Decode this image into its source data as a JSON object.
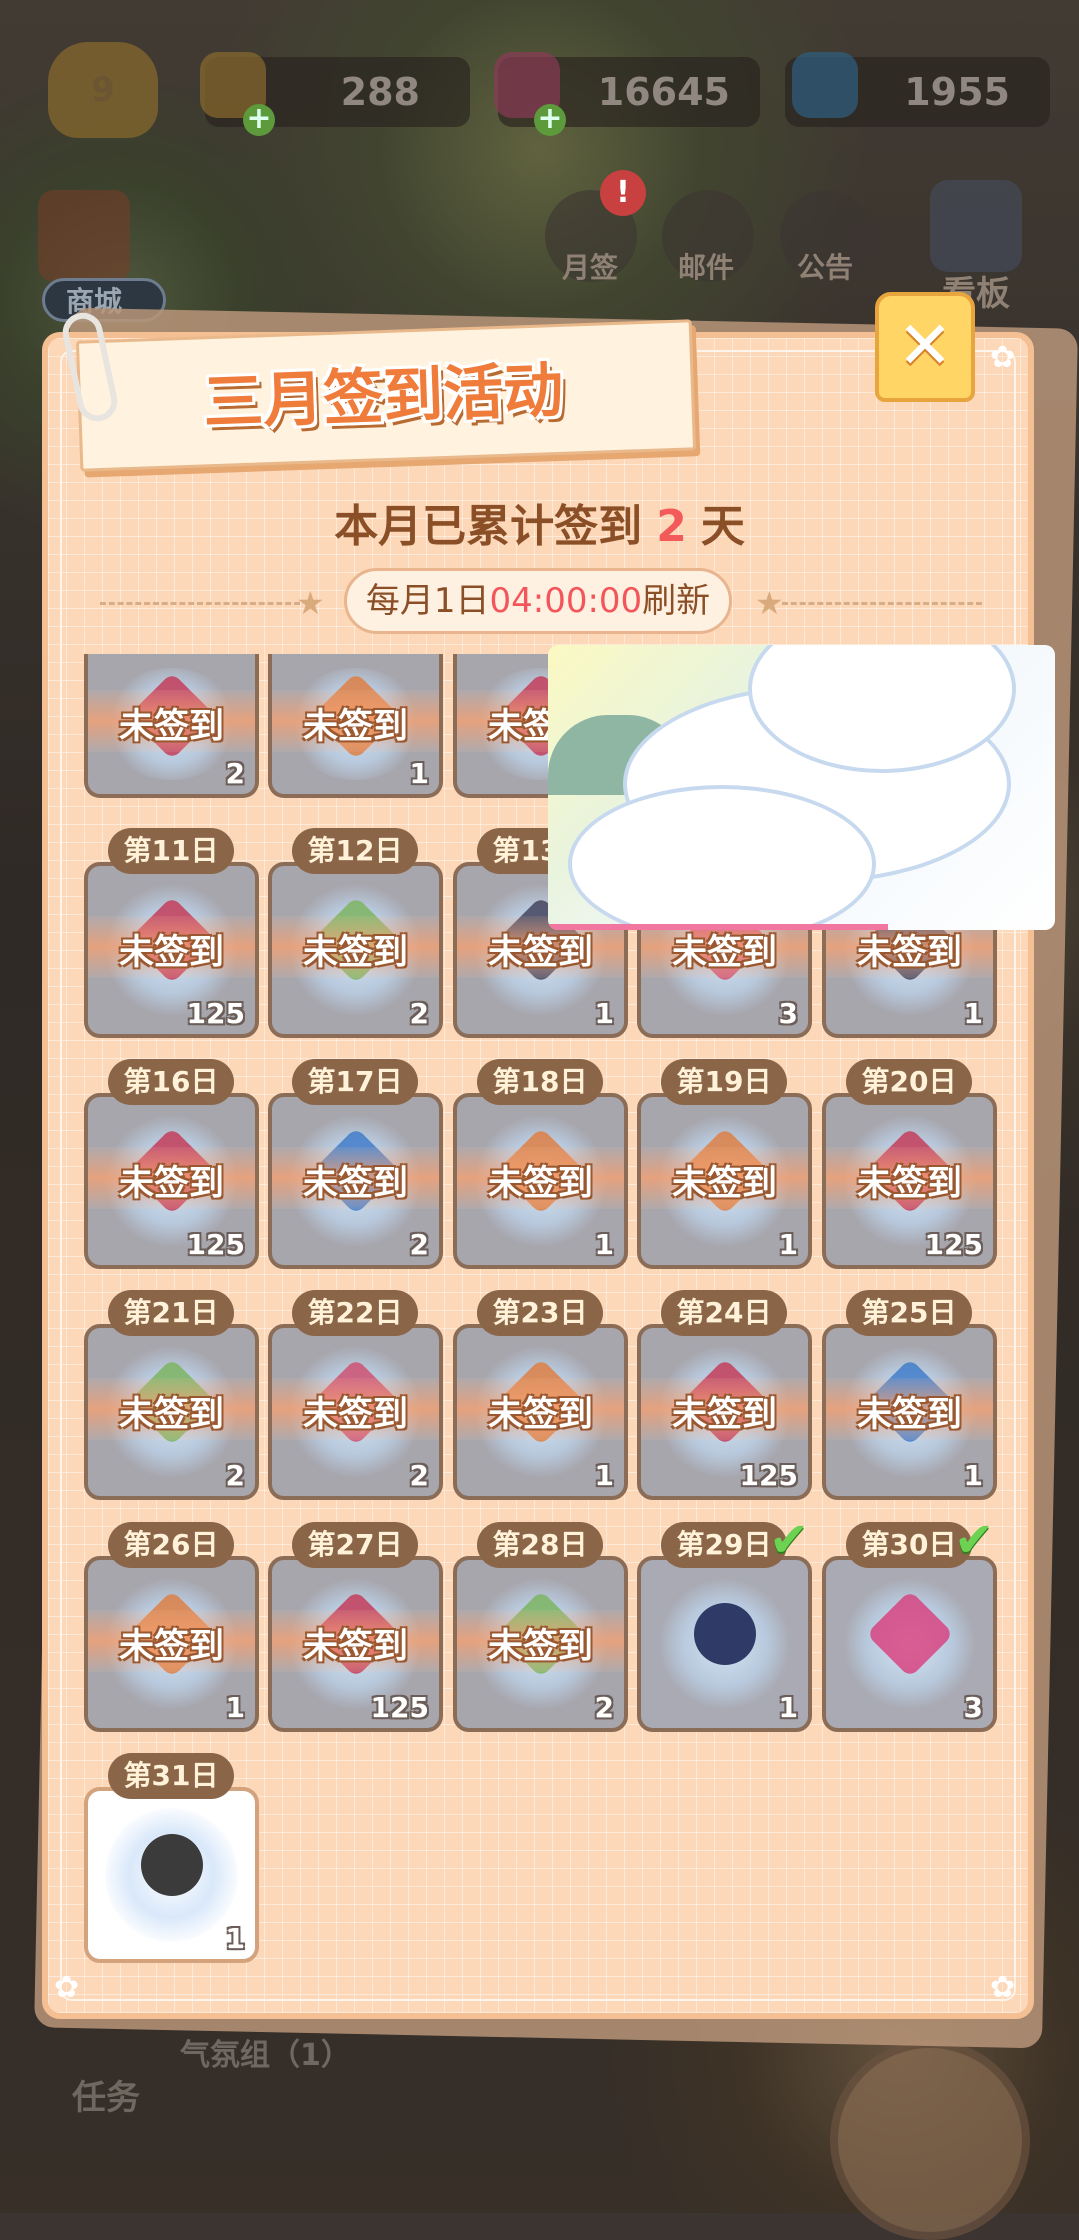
{
  "hud": {
    "level": "9",
    "bells": "288",
    "gems": "16645",
    "snowflakes": "1955",
    "shop_label": "商城",
    "mail_checkin_label": "月签",
    "mail_label": "邮件",
    "notice_label": "公告",
    "board_label": "看板",
    "task_label": "任务",
    "group_label": "气氛组（1）"
  },
  "modal": {
    "title": "三月签到活动",
    "summary_prefix": "本月已累计签到",
    "summary_count": "2",
    "summary_suffix": "天",
    "refresh_prefix": "每月1日",
    "refresh_time": "04:00:00",
    "refresh_suffix": "刷新",
    "close_icon": "close-icon"
  },
  "colors": {
    "accent": "#f07c3b",
    "panel": "#fcd7b8",
    "highlight": "#f3565a",
    "check": "#6cd251"
  },
  "rows": [
    {
      "cells": [
        {
          "day": "",
          "status": "未签到",
          "qty": "2",
          "item": "red-gem",
          "state": "pending"
        },
        {
          "day": "",
          "status": "未签到",
          "qty": "1",
          "item": "orange-item",
          "state": "pending"
        },
        {
          "day": "",
          "status": "未签到",
          "qty": "",
          "item": "red-gem",
          "state": "pending"
        }
      ]
    },
    {
      "cells": [
        {
          "day": "第11日",
          "status": "未签到",
          "qty": "125",
          "item": "red-gem",
          "state": "pending"
        },
        {
          "day": "第12日",
          "status": "未签到",
          "qty": "2",
          "item": "green-item",
          "state": "pending"
        },
        {
          "day": "第13日",
          "status": "未签到",
          "qty": "1",
          "item": "dark-item",
          "state": "pending"
        },
        {
          "day": "",
          "status": "未签到",
          "qty": "3",
          "item": "ticket",
          "state": "pending"
        },
        {
          "day": "",
          "status": "未签到",
          "qty": "1",
          "item": "dark-item",
          "state": "pending"
        }
      ]
    },
    {
      "cells": [
        {
          "day": "第16日",
          "status": "未签到",
          "qty": "125",
          "item": "red-gem",
          "state": "pending"
        },
        {
          "day": "第17日",
          "status": "未签到",
          "qty": "2",
          "item": "blue-ticket",
          "state": "pending"
        },
        {
          "day": "第18日",
          "status": "未签到",
          "qty": "1",
          "item": "orange-item",
          "state": "pending"
        },
        {
          "day": "第19日",
          "status": "未签到",
          "qty": "1",
          "item": "orange-item",
          "state": "pending"
        },
        {
          "day": "第20日",
          "status": "未签到",
          "qty": "125",
          "item": "red-gem",
          "state": "pending"
        }
      ]
    },
    {
      "cells": [
        {
          "day": "第21日",
          "status": "未签到",
          "qty": "2",
          "item": "green-item",
          "state": "pending"
        },
        {
          "day": "第22日",
          "status": "未签到",
          "qty": "2",
          "item": "ticket",
          "state": "pending"
        },
        {
          "day": "第23日",
          "status": "未签到",
          "qty": "1",
          "item": "orange-item",
          "state": "pending"
        },
        {
          "day": "第24日",
          "status": "未签到",
          "qty": "125",
          "item": "red-gem",
          "state": "pending"
        },
        {
          "day": "第25日",
          "status": "未签到",
          "qty": "1",
          "item": "blue-ticket",
          "state": "pending"
        }
      ]
    },
    {
      "cells": [
        {
          "day": "第26日",
          "status": "未签到",
          "qty": "1",
          "item": "orange-item",
          "state": "pending"
        },
        {
          "day": "第27日",
          "status": "未签到",
          "qty": "125",
          "item": "red-gem",
          "state": "pending"
        },
        {
          "day": "第28日",
          "status": "未签到",
          "qty": "2",
          "item": "green-item",
          "state": "pending"
        },
        {
          "day": "第29日",
          "status": "",
          "qty": "1",
          "item": "wristwatch",
          "state": "claimed"
        },
        {
          "day": "第30日",
          "status": "",
          "qty": "3",
          "item": "pink-ticket",
          "state": "claimed"
        }
      ]
    },
    {
      "cells": [
        {
          "day": "第31日",
          "status": "",
          "qty": "1",
          "item": "golf-bag",
          "state": "today"
        }
      ]
    }
  ]
}
